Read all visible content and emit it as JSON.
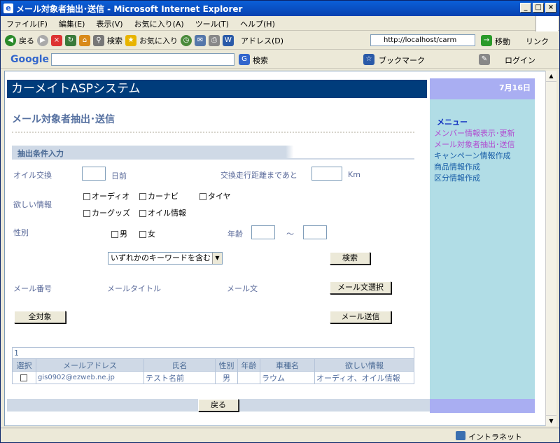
{
  "window": {
    "title": "メール対象者抽出･送信 - Microsoft Internet Explorer"
  },
  "menubar": [
    "ファイル(F)",
    "編集(E)",
    "表示(V)",
    "お気に入り(A)",
    "ツール(T)",
    "ヘルプ(H)"
  ],
  "toolbar": {
    "back": "戻る",
    "search": "検索",
    "favorites": "お気に入り",
    "address_label": "アドレス(D)",
    "address": "http://localhost/carm",
    "go": "移動",
    "links": "リンク"
  },
  "google_bar": {
    "logo": "Google",
    "search": "検索",
    "bookmarks": "ブックマーク",
    "login": "ログイン"
  },
  "status": {
    "zone": "イントラネット"
  },
  "page": {
    "banner": "カーメイトASPシステム",
    "date": "7月16日",
    "heading": "メール対象者抽出･送信",
    "section": "抽出条件入力",
    "oil_label": "オイル交換",
    "oil_unit": "日前",
    "distance_label": "交換走行距離まであと",
    "distance_unit": "Km",
    "wanted_label": "欲しい情報",
    "options": [
      "オーディオ",
      "カーナビ",
      "タイヤ",
      "カーグッズ",
      "オイル情報"
    ],
    "gender_label": "性別",
    "male": "男",
    "female": "女",
    "age_label": "年齢",
    "age_sep": "～",
    "keyword_mode": "いずれかのキーワードを含む",
    "search_button": "検索",
    "mail_no_label": "メール番号",
    "mail_title_label": "メールタイトル",
    "mail_body_label": "メール文",
    "mail_select_button": "メール文選択",
    "all_button": "全対象",
    "send_button": "メール送信",
    "result_count": "1",
    "columns": [
      "選択",
      "メールアドレス",
      "氏名",
      "性別",
      "年齢",
      "車種名",
      "欲しい情報"
    ],
    "rows": [
      {
        "email": "gis0902@ezweb.ne.jp",
        "name": "テスト名前",
        "gender": "男",
        "age": "",
        "car": "ラウム",
        "info": "オーディオ、オイル情報"
      }
    ],
    "back_button": "戻る"
  },
  "sidebar": {
    "title": "メニュー",
    "items": [
      "メンバー情報表示･更新",
      "メール対象者抽出･送信",
      "キャンペーン情報作成",
      "商品情報作成",
      "区分情報作成"
    ]
  },
  "colors": {
    "banner": "#003c7b",
    "sidebar": "#b1dde6",
    "sidebar_head": "#a9aef2",
    "link_visited": "#b14ad0",
    "link": "#1a5fa8"
  }
}
